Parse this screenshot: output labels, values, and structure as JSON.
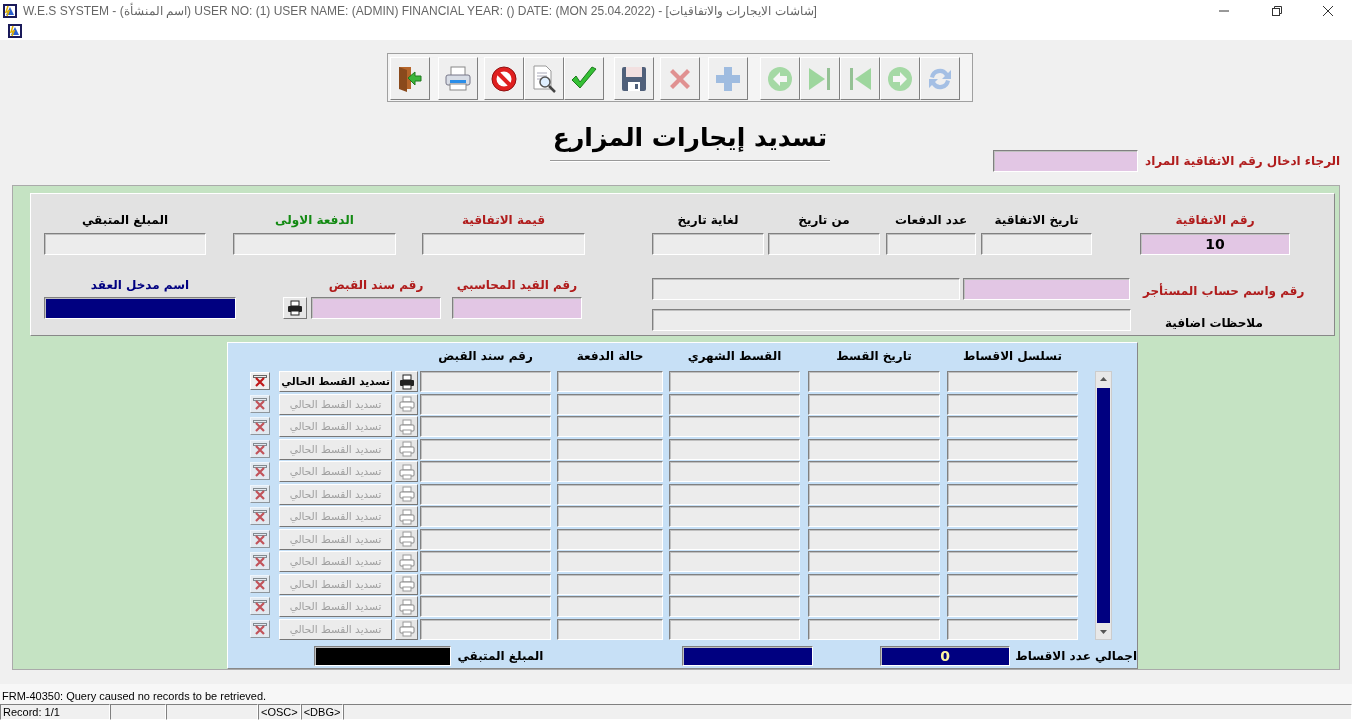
{
  "window": {
    "title": "W.E.S SYSTEM -  (اسم المنشأة)  USER NO: (1) USER NAME: (ADMIN) FINANCIAL YEAR: ()  DATE: (MON 25.04.2022) - [شاشات الايجارات والاتفاقيات]"
  },
  "toolbar": [
    [
      {
        "kind": "exit",
        "disabled": false
      }
    ],
    [
      {
        "kind": "print",
        "disabled": false
      }
    ],
    [
      {
        "kind": "cancel",
        "disabled": false
      },
      {
        "kind": "query",
        "disabled": false
      },
      {
        "kind": "accept",
        "disabled": false
      }
    ],
    [
      {
        "kind": "save",
        "disabled": false
      }
    ],
    [
      {
        "kind": "delete",
        "disabled": true
      }
    ],
    [
      {
        "kind": "insert",
        "disabled": true
      }
    ],
    [
      {
        "kind": "previous",
        "disabled": true
      },
      {
        "kind": "last",
        "disabled": true
      },
      {
        "kind": "first",
        "disabled": true
      },
      {
        "kind": "next",
        "disabled": true
      },
      {
        "kind": "refresh",
        "disabled": true
      }
    ]
  ],
  "heading": "تسديد إيجارات المزارع",
  "search": {
    "label": "الرجاء ادخال رقم الاتفاقية المراد"
  },
  "agreement": {
    "agreement_no": {
      "label": "رقم الاتفاقية",
      "value": "10"
    },
    "agreement_date": {
      "label": "تاريخ الاتفاقية"
    },
    "payments_count": {
      "label": "عدد الدفعات"
    },
    "from_date": {
      "label": "من تاريخ"
    },
    "to_date": {
      "label": "لغاية تاريخ"
    },
    "agreement_value": {
      "label": "قيمة الاتفاقية"
    },
    "first_payment": {
      "label": "الدفعة الاولى"
    },
    "remaining": {
      "label": "المبلغ المتبقي"
    },
    "tenant": {
      "label": "رقم واسم حساب المستأجر"
    },
    "notes": {
      "label": "ملاحظات اضافية"
    },
    "entered_by": {
      "label": "اسم مدخل العقد"
    },
    "receipt_no": {
      "label": "رقم سند القبض"
    },
    "journal_no": {
      "label": "رقم القيد المحاسبي"
    }
  },
  "installments": {
    "columns": [
      "تسلسل الاقساط",
      "تاريخ القسط",
      "القسط الشهري",
      "حالة الدفعة",
      "رقم سند القبض"
    ],
    "rows": [
      {
        "button": "تسديد القسط الحالي",
        "disabled": false
      },
      {
        "button": "تسديد القسط الحالي",
        "disabled": true
      },
      {
        "button": "تسديد القسط الحالي",
        "disabled": true
      },
      {
        "button": "تسديد القسط الحالي",
        "disabled": true
      },
      {
        "button": "تسديد القسط الحالي",
        "disabled": true
      },
      {
        "button": "تسديد القسط الحالي",
        "disabled": true
      },
      {
        "button": "تسديد القسط الحالي",
        "disabled": true
      },
      {
        "button": "تسديد القسط الحالي",
        "disabled": true
      },
      {
        "button": "تسديد القسط الحالي",
        "disabled": true
      },
      {
        "button": "تسديد القسط الحالي",
        "disabled": true
      },
      {
        "button": "تسديد القسط الحالي",
        "disabled": true
      },
      {
        "button": "تسديد القسط الحالي",
        "disabled": true
      }
    ],
    "totals": {
      "remaining_label": "المبلغ المتبقي",
      "count_label": "اجمالي عدد الاقساط",
      "count_value": "0"
    }
  },
  "message": "FRM-40350: Query caused no records to be retrieved.",
  "status_bar": {
    "record": "Record: 1/1",
    "osc_indicator": "<OSC>",
    "dbg_indicator": "<DBG>"
  }
}
